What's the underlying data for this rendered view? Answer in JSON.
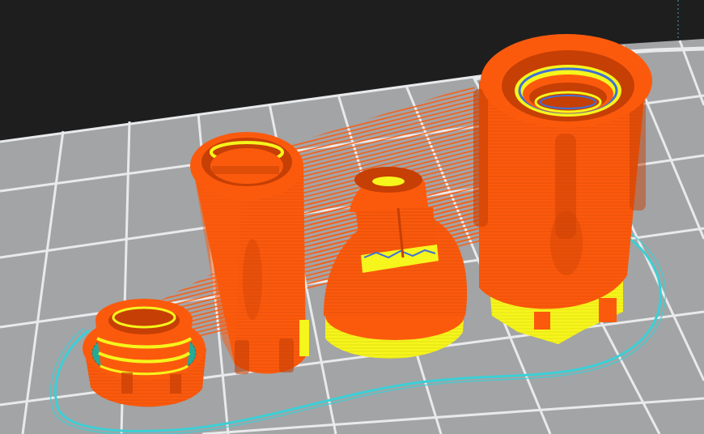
{
  "colors": {
    "background": "#1e1e1f",
    "bed": "#a3a4a6",
    "bed_grid": "#e9eaec",
    "perimeter": "#fb5a0d",
    "perimeter_dark": "#c63f05",
    "infill": "#f6f51c",
    "support_interface": "#27a99a",
    "skirt": "#39d0d6",
    "bridge": "#3f6fd6"
  }
}
